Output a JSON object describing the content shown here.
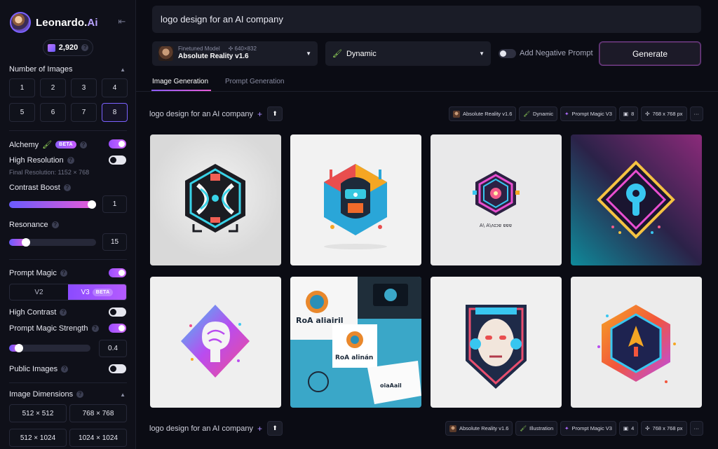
{
  "app": {
    "name": "Leonardo.",
    "name_accent": "Ai",
    "credits": "2,920"
  },
  "sidebar": {
    "number_of_images_label": "Number of Images",
    "numbers": [
      "1",
      "2",
      "3",
      "4",
      "5",
      "6",
      "7",
      "8"
    ],
    "selected_number": "8",
    "alchemy_label": "Alchemy",
    "beta": "BETA",
    "high_resolution_label": "High Resolution",
    "final_resolution": "Final Resolution: 1152 × 768",
    "contrast_boost_label": "Contrast Boost",
    "contrast_boost_value": "1",
    "resonance_label": "Resonance",
    "resonance_value": "15",
    "prompt_magic_label": "Prompt Magic",
    "prompt_magic_versions": [
      "V2",
      "V3"
    ],
    "high_contrast_label": "High Contrast",
    "prompt_magic_strength_label": "Prompt Magic Strength",
    "prompt_magic_strength_value": "0.4",
    "public_images_label": "Public Images",
    "image_dimensions_label": "Image Dimensions",
    "dimensions": [
      "512 × 512",
      "768 × 768",
      "512 × 1024",
      "1024 × 1024"
    ],
    "toggles": {
      "alchemy": true,
      "high_resolution": false,
      "prompt_magic": true,
      "high_contrast": false,
      "prompt_magic_strength": true,
      "public_images": false
    },
    "sliders": {
      "contrast_boost": 1.0,
      "resonance": 0.2,
      "prompt_magic_strength": 0.1
    }
  },
  "toolbar": {
    "prompt": "logo design for an AI company",
    "model_caption": "Finetuned Model",
    "model_size": "640×832",
    "model_name": "Absolute Reality v1.6",
    "style": "Dynamic",
    "negative_prompt_label": "Add Negative Prompt",
    "generate_label": "Generate"
  },
  "tabs": [
    "Image Generation",
    "Prompt Generation"
  ],
  "generations": [
    {
      "prompt": "logo design for an AI company",
      "chips": {
        "model": "Absolute Reality v1.6",
        "style": "Dynamic",
        "magic": "Prompt Magic V3",
        "count": "8",
        "size": "768 x 768 px",
        "more": "···"
      }
    },
    {
      "prompt": "logo design for an AI company",
      "chips": {
        "model": "Absolute Reality v1.6",
        "style": "Illustration",
        "magic": "Prompt Magic V3",
        "count": "4",
        "size": "768 x 768 px",
        "more": "···"
      }
    }
  ],
  "image_texts": {
    "tile3_caption": "A\\ A\\ʌɪɔɐ ɐɐɐ",
    "tile6_big": "RoA aliairil",
    "tile6_small": "RoA alinán",
    "tile6_right": "oiaAail"
  },
  "colors": {
    "accent": "#8b5cf6",
    "accent2": "#e95bd6",
    "background": "#0b0c14"
  }
}
